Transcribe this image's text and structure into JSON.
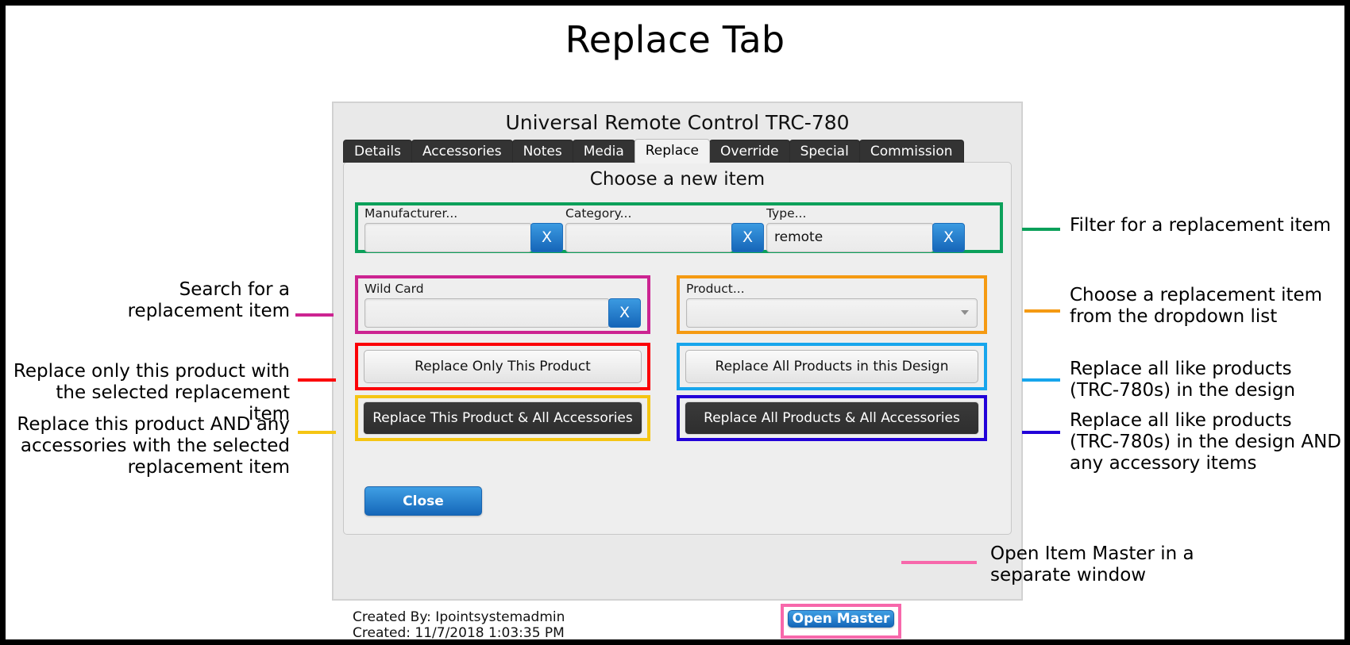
{
  "page": {
    "title": "Replace Tab"
  },
  "dialog": {
    "title": "Universal Remote Control TRC-780",
    "tabs": [
      {
        "label": "Details",
        "active": false
      },
      {
        "label": "Accessories",
        "active": false
      },
      {
        "label": "Notes",
        "active": false
      },
      {
        "label": "Media",
        "active": false
      },
      {
        "label": "Replace",
        "active": true
      },
      {
        "label": "Override",
        "active": false
      },
      {
        "label": "Special",
        "active": false
      },
      {
        "label": "Commission",
        "active": false
      }
    ],
    "panel_heading": "Choose a new item",
    "filters": [
      {
        "label": "Manufacturer...",
        "value": "",
        "clear_label": "X"
      },
      {
        "label": "Category...",
        "value": "",
        "clear_label": "X"
      },
      {
        "label": "Type...",
        "value": "remote",
        "clear_label": "X"
      }
    ],
    "wildcard": {
      "label": "Wild Card",
      "value": "",
      "clear_label": "X"
    },
    "product": {
      "label": "Product...",
      "value": "",
      "placeholder": ""
    },
    "buttons": {
      "replace_only_this_product": "Replace Only This Product",
      "replace_all_products_in_design": "Replace All Products in this Design",
      "replace_this_product_all_accessories": "Replace This Product & All Accessories",
      "replace_all_products_all_accessories": "Replace All Products & All Accessories",
      "close": "Close",
      "open_master": "Open Master"
    },
    "footer": {
      "created_by": "Created By: Ipointsystemadmin",
      "created": "Created: 11/7/2018 1:03:35 PM"
    }
  },
  "callouts": {
    "filter": "Filter for a replacement item",
    "choose": "Choose a replacement item\nfrom the dropdown list",
    "search": "Search for a\nreplacement item",
    "replace_only": "Replace only this product with\nthe selected replacement item",
    "replace_and_acc": "Replace this product AND any\naccessories with the selected\nreplacement item",
    "replace_all": "Replace all like products\n(TRC-780s) in the design",
    "replace_all_acc": "Replace all like products\n(TRC-780s) in the design AND\nany accessory items",
    "open_master": "Open Item Master in a\nseparate window"
  },
  "highlight_colors": {
    "green": "#0ba05a",
    "magenta": "#cc2491",
    "orange": "#f59a12",
    "red": "#fb0007",
    "cyan": "#17a5ec",
    "yellow": "#f5c513",
    "blue": "#2200d8",
    "pink": "#f768ab"
  }
}
